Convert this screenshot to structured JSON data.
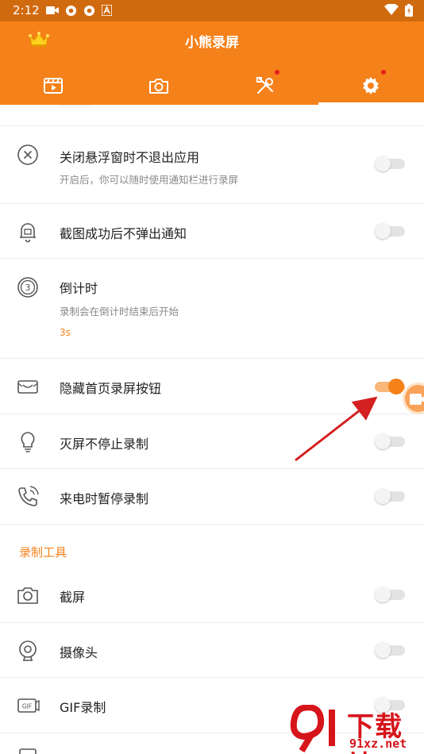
{
  "status_bar": {
    "time": "2:12"
  },
  "header": {
    "title": "小熊录屏"
  },
  "tabs": [
    {
      "name": "video"
    },
    {
      "name": "camera"
    },
    {
      "name": "tools",
      "has_dot": true
    },
    {
      "name": "settings",
      "has_dot": true,
      "active": true
    }
  ],
  "settings": [
    {
      "label": "关闭悬浮窗时不退出应用",
      "desc": "开启后，你可以随时使用通知栏进行录屏",
      "icon": "close-circle-icon",
      "on": false
    },
    {
      "label": "截图成功后不弹出通知",
      "icon": "bell-icon",
      "on": false
    },
    {
      "label": "倒计时",
      "desc": "录制会在倒计时结束后开始",
      "value": "3s",
      "icon": "countdown-icon"
    },
    {
      "label": "隐藏首页录屏按钮",
      "icon": "hide-button-icon",
      "on": true
    },
    {
      "label": "灭屏不停止录制",
      "icon": "lightbulb-icon",
      "on": false
    },
    {
      "label": "来电时暂停录制",
      "icon": "phone-call-icon",
      "on": false
    }
  ],
  "tools_section": {
    "title": "录制工具",
    "items": [
      {
        "label": "截屏",
        "icon": "camera-icon",
        "on": false
      },
      {
        "label": "摄像头",
        "icon": "webcam-icon",
        "on": false
      },
      {
        "label": "GIF录制",
        "icon": "gif-icon",
        "on": false
      }
    ]
  },
  "watermark": {
    "text_cn": "下载站",
    "text_url": "91xz.net"
  },
  "colors": {
    "accent": "#f5811a",
    "header": "#f5811a",
    "status_bar": "#d06a0f",
    "arrow": "#d42020"
  }
}
